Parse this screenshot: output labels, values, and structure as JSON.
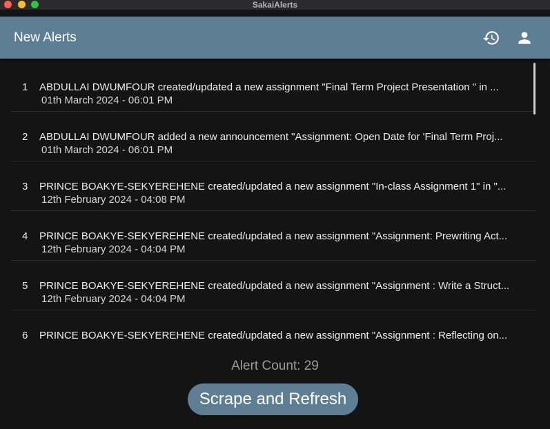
{
  "window": {
    "title": "SakaiAlerts"
  },
  "appbar": {
    "title": "New Alerts",
    "actions": [
      {
        "icon": "history-icon"
      },
      {
        "icon": "person-icon"
      }
    ]
  },
  "alerts": [
    {
      "index": "1",
      "text": "ABDULLAI DWUMFOUR created/updated a new assignment \"Final Term Project Presentation \" in ...",
      "date": "01th March 2024 - 06:01 PM"
    },
    {
      "index": "2",
      "text": "ABDULLAI DWUMFOUR added a new announcement \"Assignment: Open Date for 'Final Term Proj...",
      "date": "01th March 2024 - 06:01 PM"
    },
    {
      "index": "3",
      "text": "PRINCE BOAKYE-SEKYEREHENE created/updated a new assignment \"In-class Assignment 1\" in \"...",
      "date": "12th February 2024 - 04:08 PM"
    },
    {
      "index": "4",
      "text": "PRINCE BOAKYE-SEKYEREHENE created/updated a new assignment \"Assignment: Prewriting Act...",
      "date": "12th February 2024 - 04:04 PM"
    },
    {
      "index": "5",
      "text": "PRINCE BOAKYE-SEKYEREHENE created/updated a new assignment \"Assignment : Write a Struct...",
      "date": "12th February 2024 - 04:04 PM"
    },
    {
      "index": "6",
      "text": "PRINCE BOAKYE-SEKYEREHENE created/updated a new assignment \"Assignment : Reflecting on...",
      "date": ""
    }
  ],
  "footer": {
    "count_label": "Alert Count: 29",
    "refresh_label": "Scrape and Refresh"
  },
  "colors": {
    "accent": "#5e7f93",
    "background": "#141415"
  }
}
